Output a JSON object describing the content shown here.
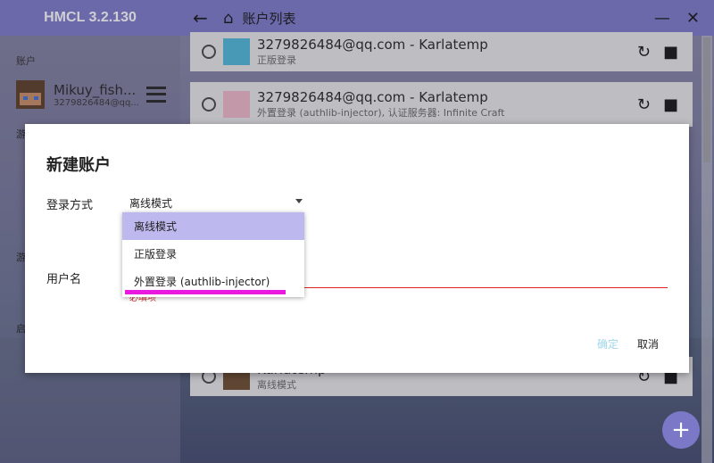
{
  "app": {
    "title": "HMCL 3.2.130"
  },
  "sidebar": {
    "section_account": "账户",
    "current_account": {
      "name": "Mikuy_fish...",
      "email": "3279826484@qq..."
    },
    "section_game": "游",
    "section_game2": "游",
    "section_launch": "启"
  },
  "header": {
    "title": "账户列表"
  },
  "accounts": [
    {
      "name": "3279826484@qq.com - Karlatemp",
      "sub": "正版登录"
    },
    {
      "name": "3279826484@qq.com - Karlatemp",
      "sub": "外置登录 (authlib-injector), 认证服务器: Infinite Craft"
    },
    {
      "name": "Karlatemp",
      "sub": "离线模式"
    }
  ],
  "dialog": {
    "title": "新建账户",
    "login_method_label": "登录方式",
    "login_method_value": "离线模式",
    "username_label": "用户名",
    "required_hint": "必填项",
    "confirm_label": "确定",
    "cancel_label": "取消"
  },
  "dropdown": {
    "options": [
      "离线模式",
      "正版登录",
      "外置登录 (authlib-injector)"
    ],
    "selected": "离线模式"
  },
  "colors": {
    "accent": "#7b78c8",
    "highlight": "#e81ae0",
    "error": "#dd2222"
  },
  "icons": {
    "back": "arrow-left-icon",
    "home": "home-icon",
    "minimize": "minimize-icon",
    "close": "close-icon",
    "refresh": "refresh-icon",
    "delete": "trash-icon",
    "add": "plus-icon"
  }
}
